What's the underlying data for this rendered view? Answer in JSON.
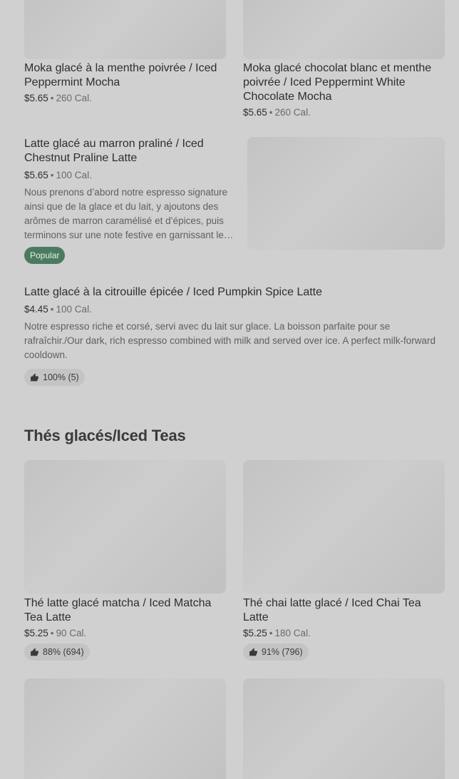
{
  "items": [
    {
      "title": "Moka glacé à la menthe poivrée / Iced Peppermint Mocha",
      "price": "$5.65",
      "calories": "260 Cal."
    },
    {
      "title": "Moka glacé chocolat blanc et menthe poivrée / Iced Peppermint White Chocolate Mocha",
      "price": "$5.65",
      "calories": "260 Cal."
    },
    {
      "title": "Latte glacé au marron praliné / Iced Chestnut Praline Latte",
      "price": "$5.65",
      "calories": "100 Cal.",
      "description": "Nous prenons d’abord notre espresso signature ainsi que de la glace et du lait, y ajoutons des arômes de marron caramélisé et d’épices, puis terminons sur une note festive en garnissant le tout de crème fouettée.",
      "badge": "Popular"
    },
    {
      "title": "Latte glacé à la citrouille épicée / Iced Pumpkin Spice Latte",
      "price": "$4.45",
      "calories": "100 Cal.",
      "description": "Notre espresso riche et corsé, servi avec du lait sur glace. La boisson parfaite pour se rafraîchir./Our dark, rich espresso combined with milk and served over ice. A perfect milk-forward cooldown.",
      "rating": "100% (5)"
    }
  ],
  "section": {
    "title": "Thés glacés/Iced Teas"
  },
  "teas": [
    {
      "title": "Thé latte glacé matcha / Iced Matcha Tea Latte",
      "price": "$5.25",
      "calories": "90 Cal.",
      "rating": "88% (694)"
    },
    {
      "title": "Thé chai latte glacé / Iced Chai Tea Latte",
      "price": "$5.25",
      "calories": "180 Cal.",
      "rating": "91% (796)"
    }
  ],
  "meta_separator": "•",
  "icons": {
    "thumbs_up": "thumbs-up-icon"
  }
}
